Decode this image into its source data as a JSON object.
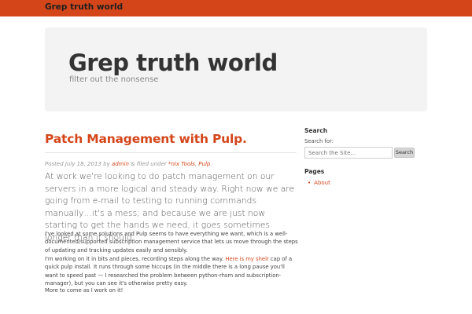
{
  "topbar": {
    "brand": "Grep truth world"
  },
  "hero": {
    "title": "Grep truth world",
    "tagline": "filter out the nonsense"
  },
  "post": {
    "title": "Patch Management with Pulp.",
    "meta": {
      "posted_prefix": "Posted",
      "date": "July 18, 2013",
      "by": "by",
      "author": "admin",
      "filed_under": "& filed under",
      "category_1": "*nix Tools",
      "separator": ",",
      "category_2": "Pulp",
      "end": "."
    },
    "lead": "At work we're looking to do patch management on our servers in a more logical and steady way. Right now we are going from e-mail to testing to running commands manually…it's a mess; and because we are just now starting to get the hands we need, it goes sometimes longer than it should.",
    "para1": "I've looked at some solutions and Pulp seems to have everything we want, which is a well-documented/supported subscription management service that lets us move through the steps of updating and tracking updates easily and sensibly.",
    "para2_before": "I'm working on it in bits and pieces, recording steps along the way.",
    "para2_link": "Here is my shelr",
    "para2_after": "cap of a quick pulp install. It runs through some hiccups (in the middle there is a long pause you'll want to speed past — I researched the problem between python-rhsm and subscription-manager), but you can see it's otherwise pretty easy.",
    "para3": "More to come as I work on it!"
  },
  "sidebar": {
    "search_title": "Search",
    "search_label": "Search for:",
    "search_placeholder": "Search the Site...",
    "search_button": "Search",
    "pages_title": "Pages",
    "pages": [
      "About"
    ]
  },
  "colors": {
    "accent": "#d4461a",
    "hero_bg": "#f3f3f3",
    "text": "#333333"
  }
}
